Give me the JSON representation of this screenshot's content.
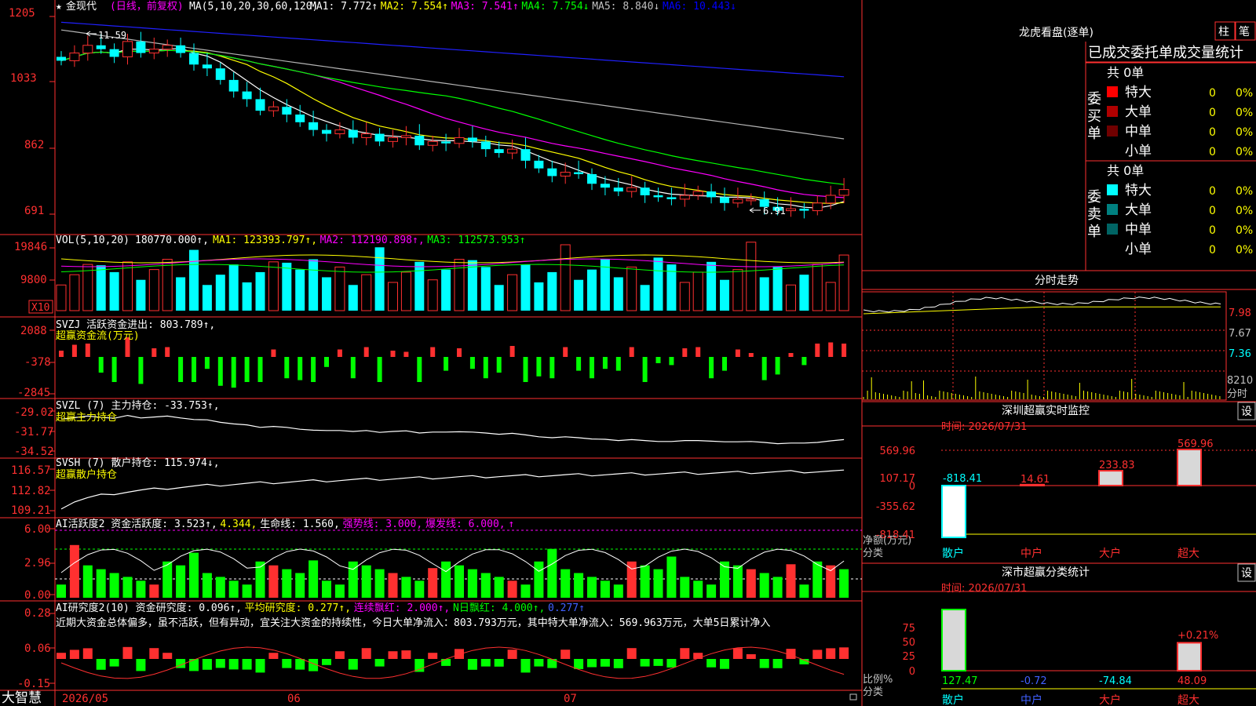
{
  "main": {
    "star": "★",
    "name": "金现代",
    "period": "(日线，前复权)",
    "ma_label": "MA(5,10,20,30,60,120)",
    "ma_items": [
      {
        "text": "MA1: 7.772↑",
        "color": "#ffffff"
      },
      {
        "text": "MA2: 7.554↑",
        "color": "#ffff00"
      },
      {
        "text": "MA3: 7.541↑",
        "color": "#ff00ff"
      },
      {
        "text": "MA4: 7.754↓",
        "color": "#00ff00"
      },
      {
        "text": "MA5: 8.840↓",
        "color": "#c0c0c0"
      },
      {
        "text": "MA6: 10.443↓",
        "color": "#0000ff"
      }
    ],
    "y_labels": [
      "1205",
      "1033",
      "862",
      "691"
    ],
    "high_marker": "11.59",
    "low_marker": "6.91",
    "ma_colors": [
      "#ffffff",
      "#ffff00",
      "#ff00ff",
      "#00ff00",
      "#b4b4b4",
      "#2020ff"
    ]
  },
  "vol": {
    "title": "VOL(5,10,20)",
    "value": "180770.000↑,",
    "items": [
      {
        "text": "MA1: 123393.797↑,",
        "color": "#ffff00"
      },
      {
        "text": "MA2: 112190.898↑,",
        "color": "#ff00ff"
      },
      {
        "text": "MA3: 112573.953↑",
        "color": "#00ff00"
      }
    ],
    "y_labels": [
      "19846",
      "9800"
    ],
    "unit": "X10"
  },
  "svzj": {
    "line1": "SVZJ  活跃资金进出: 803.789↑,",
    "line2": "超赢资金流(万元)",
    "y_labels": [
      "2088",
      "-378",
      "-2845"
    ]
  },
  "svzl": {
    "line1": "SVZL (7) 主力持仓: -33.753↑,",
    "line2": "超赢主力持仓",
    "y_labels": [
      "-29.02",
      "-31.77",
      "-34.52"
    ]
  },
  "svsh": {
    "line1": "SVSH (7) 散户持仓: 115.974↓,",
    "line2": "超赢散户持仓",
    "y_labels": [
      "116.57",
      "112.82",
      "109.21"
    ]
  },
  "ai": {
    "items": [
      {
        "text": "AI活跃度2 资金活跃度: 3.523↑,",
        "color": "#ffffff"
      },
      {
        "text": "4.344,",
        "color": "#ffff00"
      },
      {
        "text": "生命线: 1.560,",
        "color": "#ffffff"
      },
      {
        "text": "强势线: 3.000,",
        "color": "#ff00ff"
      },
      {
        "text": "爆发线: 6.000,",
        "color": "#ff00ff"
      },
      {
        "text": "↑",
        "color": "#ff00ff"
      }
    ],
    "y_labels": [
      "6.00",
      "2.96",
      "0.00"
    ]
  },
  "ai_research": {
    "items": [
      {
        "text": "AI研究度2(10) 资金研究度: 0.096↑,",
        "color": "#ffffff"
      },
      {
        "text": "平均研究度: 0.277↑,",
        "color": "#ffff00"
      },
      {
        "text": "连续飘红: 2.000↑,",
        "color": "#ff00ff"
      },
      {
        "text": "N日飘红: 4.000↑,",
        "color": "#00ff00"
      },
      {
        "text": "0.277↑",
        "color": "#4060ff"
      }
    ],
    "sentence": "近期大资金总体偏多，虽不活跃，但有异动，宜关注大资金的持续性，今日大单净流入：803.793万元，其中特大单净流入：569.963万元，大单5日累计净入",
    "y_labels": [
      "0.28",
      "0.06",
      "-0.15"
    ]
  },
  "bottom": {
    "brand": "大智慧",
    "dates": [
      "2026/05",
      "06",
      "07"
    ]
  },
  "lhb": {
    "title": "龙虎看盘(逐单)",
    "btn_zhu": "柱",
    "btn_bi": "笔",
    "tabs": [
      "已成交",
      "委托单",
      "成交量统计"
    ],
    "buy": {
      "side": [
        "委",
        "买",
        "单"
      ],
      "total": "共 0单",
      "rows": [
        {
          "label": "特大",
          "count": "0",
          "pct": "0%",
          "color": "#ff0000"
        },
        {
          "label": "大单",
          "count": "0",
          "pct": "0%",
          "color": "#b00000"
        },
        {
          "label": "中单",
          "count": "0",
          "pct": "0%",
          "color": "#700000"
        },
        {
          "label": "小单",
          "count": "0",
          "pct": "0%",
          "color": ""
        }
      ]
    },
    "sell": {
      "side": [
        "委",
        "卖",
        "单"
      ],
      "total": "共 0单",
      "rows": [
        {
          "label": "特大",
          "count": "0",
          "pct": "0%",
          "color": "#00ffff"
        },
        {
          "label": "大单",
          "count": "0",
          "pct": "0%",
          "color": "#008080"
        },
        {
          "label": "中单",
          "count": "0",
          "pct": "0%",
          "color": "#006464"
        },
        {
          "label": "小单",
          "count": "0",
          "pct": "0%",
          "color": ""
        }
      ]
    }
  },
  "intraday": {
    "title": "分时走势",
    "y_labels": [
      "7.98",
      "7.67",
      "7.36"
    ],
    "vol_label": "8210",
    "vol_unit": "分时"
  },
  "monitor": {
    "title": "深圳超赢实时监控",
    "set": "设",
    "time": "时间: 2026/07/31",
    "y_labels": [
      "569.96",
      "107.17",
      "0",
      "-355.62",
      "-818.41"
    ],
    "values": [
      -818.41,
      14.61,
      233.83,
      569.96
    ],
    "value_labels": [
      "-818.41",
      "14.61",
      "233.83",
      "569.96"
    ],
    "categories": [
      "散户",
      "中户",
      "大户",
      "超大"
    ],
    "axis_caption": [
      "净额(万元)",
      "分类"
    ]
  },
  "stats": {
    "title": "深市超赢分类统计",
    "set": "设",
    "time": "时间: 2026/07/31",
    "y_labels": [
      "75",
      "50",
      "25",
      "0"
    ],
    "values": [
      127.47,
      -0.72,
      -74.84,
      48.09
    ],
    "value_labels": [
      "127.47",
      "-0.72",
      "-74.84",
      "48.09"
    ],
    "top_label": "+0.21%",
    "categories": [
      "散户",
      "中户",
      "大户",
      "超大"
    ],
    "axis_caption": [
      "比例%",
      "分类"
    ]
  }
}
